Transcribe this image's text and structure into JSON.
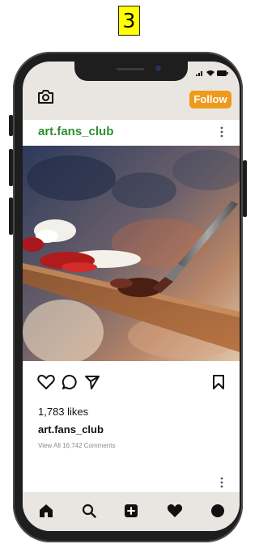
{
  "step": {
    "number": "3"
  },
  "post": {
    "username": "art.fans_club",
    "follow_label": "Follow",
    "likes_text": "1,783 likes",
    "caption_user": "art.fans_club",
    "comments_text": "View All 16,742 Comments"
  },
  "icons": {
    "camera": "camera-icon",
    "more": "more-vertical-icon",
    "like": "heart-outline-icon",
    "comment": "comment-bubble-icon",
    "share": "send-icon",
    "save": "bookmark-icon",
    "nav": [
      "home-icon",
      "search-icon",
      "add-post-icon",
      "activity-heart-icon",
      "profile-icon"
    ]
  },
  "colors": {
    "follow_button": "#f09a1c",
    "username": "#2f8f2f",
    "step_badge": "#ffff00",
    "phone_body": "#1e1e1e",
    "screen_bg": "#e9e6e1"
  }
}
